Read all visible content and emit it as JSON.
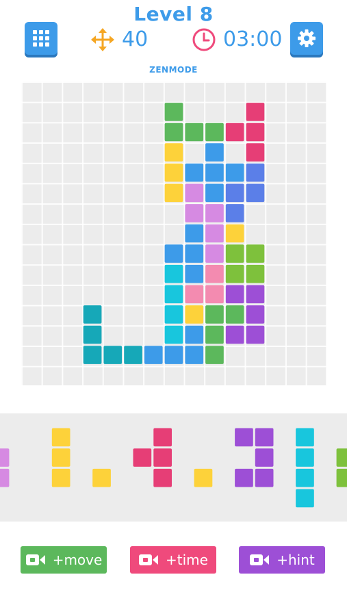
{
  "header": {
    "title": "Level 8",
    "moves": "40",
    "timer": "03:00",
    "mode": "ZENMODE"
  },
  "colors": {
    "accent": "#3d9be9",
    "green": "#5cb85c",
    "pink": "#e63e76",
    "blue": "#3d9be9",
    "indigo": "#5b7fe8",
    "yellow": "#fdd23a",
    "violet": "#d68ae2",
    "lime": "#7ec13c",
    "purple": "#9d4fd6",
    "cyan": "#18c6dd",
    "rose": "#f38bb0",
    "teal": "#16a8b8"
  },
  "board": {
    "cols": 15,
    "rows": 15,
    "cells": [
      [
        7,
        1,
        "green"
      ],
      [
        11,
        1,
        "pink"
      ],
      [
        7,
        2,
        "green"
      ],
      [
        8,
        2,
        "green"
      ],
      [
        9,
        2,
        "green"
      ],
      [
        10,
        2,
        "pink"
      ],
      [
        11,
        2,
        "pink"
      ],
      [
        7,
        3,
        "yellow"
      ],
      [
        9,
        3,
        "blue"
      ],
      [
        11,
        3,
        "pink"
      ],
      [
        7,
        4,
        "yellow"
      ],
      [
        8,
        4,
        "blue"
      ],
      [
        9,
        4,
        "blue"
      ],
      [
        10,
        4,
        "blue"
      ],
      [
        11,
        4,
        "indigo"
      ],
      [
        7,
        5,
        "yellow"
      ],
      [
        8,
        5,
        "violet"
      ],
      [
        9,
        5,
        "blue"
      ],
      [
        10,
        5,
        "indigo"
      ],
      [
        11,
        5,
        "indigo"
      ],
      [
        8,
        6,
        "violet"
      ],
      [
        9,
        6,
        "violet"
      ],
      [
        10,
        6,
        "indigo"
      ],
      [
        8,
        7,
        "blue"
      ],
      [
        9,
        7,
        "violet"
      ],
      [
        10,
        7,
        "yellow"
      ],
      [
        7,
        8,
        "blue"
      ],
      [
        8,
        8,
        "blue"
      ],
      [
        9,
        8,
        "violet"
      ],
      [
        10,
        8,
        "lime"
      ],
      [
        11,
        8,
        "lime"
      ],
      [
        7,
        9,
        "cyan"
      ],
      [
        8,
        9,
        "blue"
      ],
      [
        9,
        9,
        "rose"
      ],
      [
        10,
        9,
        "lime"
      ],
      [
        11,
        9,
        "lime"
      ],
      [
        7,
        10,
        "cyan"
      ],
      [
        8,
        10,
        "rose"
      ],
      [
        9,
        10,
        "rose"
      ],
      [
        10,
        10,
        "purple"
      ],
      [
        11,
        10,
        "purple"
      ],
      [
        3,
        11,
        "teal"
      ],
      [
        7,
        11,
        "cyan"
      ],
      [
        8,
        11,
        "yellow"
      ],
      [
        9,
        11,
        "green"
      ],
      [
        10,
        11,
        "green"
      ],
      [
        11,
        11,
        "purple"
      ],
      [
        3,
        12,
        "teal"
      ],
      [
        7,
        12,
        "cyan"
      ],
      [
        8,
        12,
        "blue"
      ],
      [
        9,
        12,
        "green"
      ],
      [
        10,
        12,
        "purple"
      ],
      [
        11,
        12,
        "purple"
      ],
      [
        3,
        13,
        "teal"
      ],
      [
        4,
        13,
        "teal"
      ],
      [
        5,
        13,
        "teal"
      ],
      [
        6,
        13,
        "blue"
      ],
      [
        7,
        13,
        "blue"
      ],
      [
        8,
        13,
        "blue"
      ],
      [
        9,
        13,
        "green"
      ]
    ]
  },
  "tray": {
    "pieces": [
      {
        "color": "violet",
        "cells": [
          [
            0,
            1
          ],
          [
            1,
            1
          ],
          [
            0,
            2
          ],
          [
            1,
            2
          ]
        ],
        "offset": -1.5
      },
      {
        "color": "yellow",
        "cells": [
          [
            0,
            0
          ],
          [
            0,
            1
          ],
          [
            0,
            2
          ]
        ],
        "offset": 2.5
      },
      {
        "color": "yellow",
        "cells": [
          [
            0,
            2
          ]
        ],
        "offset": 4.5
      },
      {
        "color": "pink",
        "cells": [
          [
            1,
            0
          ],
          [
            0,
            1
          ],
          [
            1,
            1
          ],
          [
            1,
            2
          ]
        ],
        "offset": 6.5
      },
      {
        "color": "yellow",
        "cells": [
          [
            0,
            2
          ]
        ],
        "offset": 9.5
      },
      {
        "color": "purple",
        "cells": [
          [
            0,
            0
          ],
          [
            1,
            0
          ],
          [
            1,
            1
          ],
          [
            0,
            2
          ],
          [
            1,
            2
          ]
        ],
        "offset": 11.5
      },
      {
        "color": "cyan",
        "cells": [
          [
            0,
            0
          ],
          [
            0,
            1
          ],
          [
            0,
            2
          ],
          [
            0,
            3
          ]
        ],
        "offset": 14.5
      },
      {
        "color": "lime",
        "cells": [
          [
            0,
            1
          ],
          [
            0,
            2
          ]
        ],
        "offset": 16.5
      }
    ]
  },
  "actions": {
    "move_label": "+move",
    "time_label": "+time",
    "hint_label": "+hint"
  }
}
